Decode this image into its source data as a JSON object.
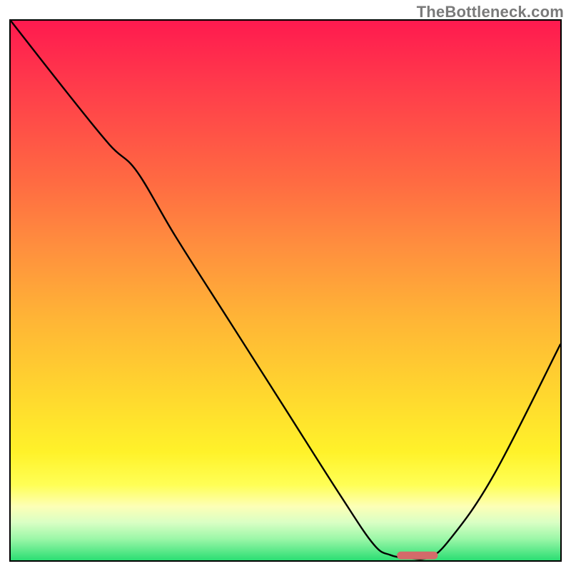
{
  "watermark": "TheBottleneck.com",
  "chart_data": {
    "type": "line",
    "title": "",
    "xlabel": "",
    "ylabel": "",
    "xlim": [
      0,
      100
    ],
    "ylim": [
      0,
      100
    ],
    "series": [
      {
        "name": "curve",
        "x": [
          0,
          10,
          18,
          23,
          30,
          40,
          50,
          60,
          66,
          69,
          72,
          76,
          80,
          88,
          100
        ],
        "values": [
          100,
          87,
          77,
          72,
          60,
          44,
          28,
          12,
          3,
          1,
          0.5,
          0.5,
          4,
          16,
          40
        ]
      }
    ],
    "flat_segment": {
      "x_start": 71,
      "x_end": 77,
      "y": 0.9
    },
    "colors": {
      "gradient_top": "#ff1a4f",
      "gradient_mid": "#ffd42f",
      "gradient_bottom": "#2bde73",
      "line": "#000000",
      "marker": "#d46a6a"
    }
  }
}
